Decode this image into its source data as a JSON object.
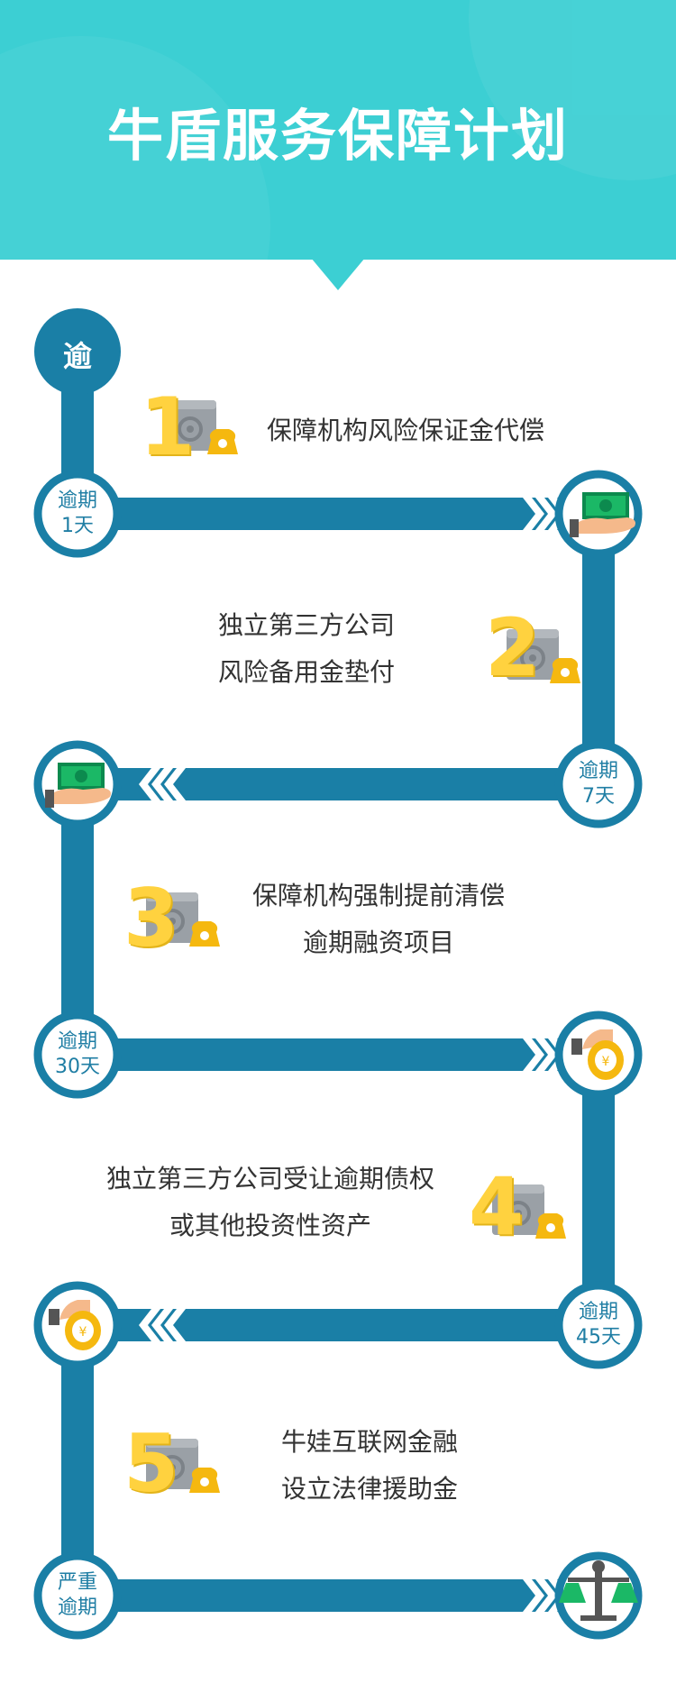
{
  "header": {
    "title": "牛盾服务保障计划"
  },
  "start_label": "逾",
  "nodes": [
    {
      "line1": "逾期",
      "line2": "1天"
    },
    {
      "line1": "逾期",
      "line2": "7天"
    },
    {
      "line1": "逾期",
      "line2": "30天"
    },
    {
      "line1": "逾期",
      "line2": "45天"
    },
    {
      "line1": "严重",
      "line2": "逾期"
    }
  ],
  "steps": [
    {
      "number": "1",
      "line1": "保障机构风险保证金代偿",
      "line2": ""
    },
    {
      "number": "2",
      "line1": "独立第三方公司",
      "line2": "风险备用金垫付"
    },
    {
      "number": "3",
      "line1": "保障机构强制提前清偿",
      "line2": "逾期融资项目"
    },
    {
      "number": "4",
      "line1": "独立第三方公司受让逾期债权",
      "line2": "或其他投资性资产"
    },
    {
      "number": "5",
      "line1": "牛娃互联网金融",
      "line2": "设立法律援助金"
    }
  ],
  "colors": {
    "header": "#3ccfd3",
    "path": "#1a7fa6",
    "accent": "#ffd23f",
    "text": "#333333"
  },
  "icons": [
    "safe-icon",
    "cash-hand-icon",
    "coin-bag-icon",
    "scales-icon"
  ]
}
